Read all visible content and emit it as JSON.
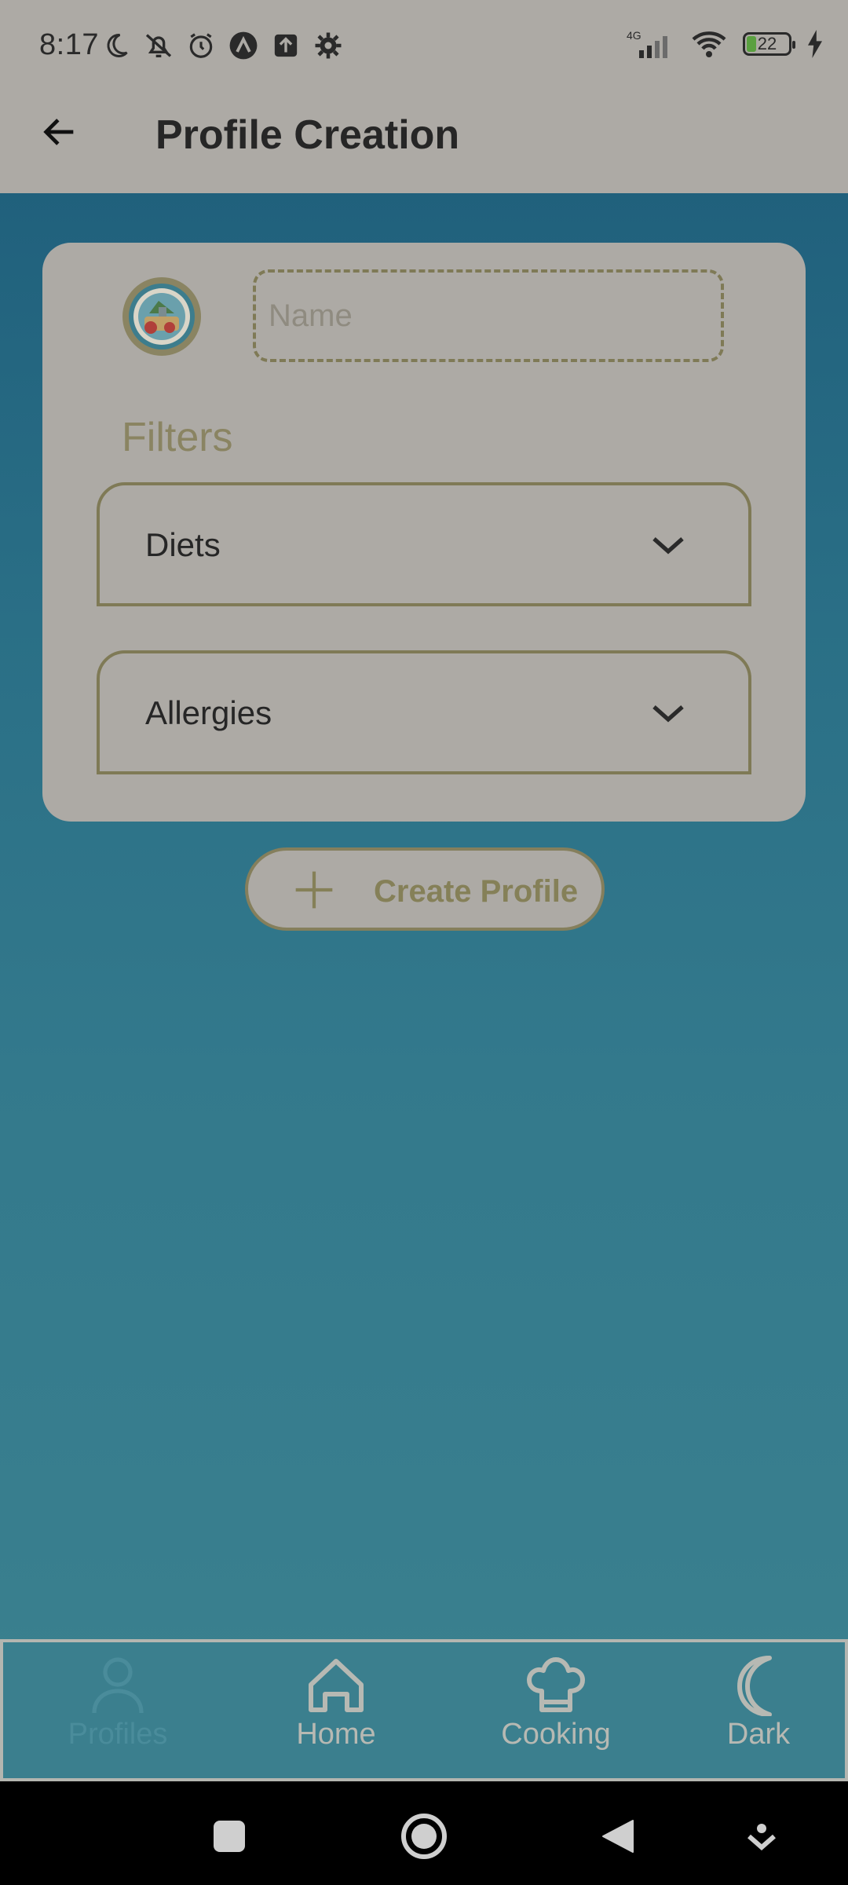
{
  "status_bar": {
    "time": "8:17",
    "network": "4G",
    "battery": "22",
    "icons": [
      "moon-icon",
      "silent-icon",
      "alarm-icon",
      "app-icon",
      "upload-icon",
      "gear-icon",
      "signal-icon",
      "wifi-icon",
      "battery-icon",
      "charging-icon"
    ]
  },
  "app_bar": {
    "title": "Profile Creation"
  },
  "profile_card": {
    "name_placeholder": "Name",
    "name_value": "",
    "filters_label": "Filters",
    "dropdowns": [
      {
        "label": "Diets"
      },
      {
        "label": "Allergies"
      }
    ]
  },
  "create_button": {
    "label": "Create Profile"
  },
  "bottom_nav": {
    "items": [
      {
        "label": "Profiles",
        "icon": "person-icon",
        "active": true
      },
      {
        "label": "Home",
        "icon": "home-icon"
      },
      {
        "label": "Cooking",
        "icon": "chef-hat-icon"
      },
      {
        "label": "Dark",
        "icon": "moon-icon"
      }
    ]
  },
  "colors": {
    "accent_olive": "#8a8462",
    "surface": "#adaaa5",
    "gradient_top": "#1c5a78",
    "gradient_bottom": "#3b818f"
  }
}
